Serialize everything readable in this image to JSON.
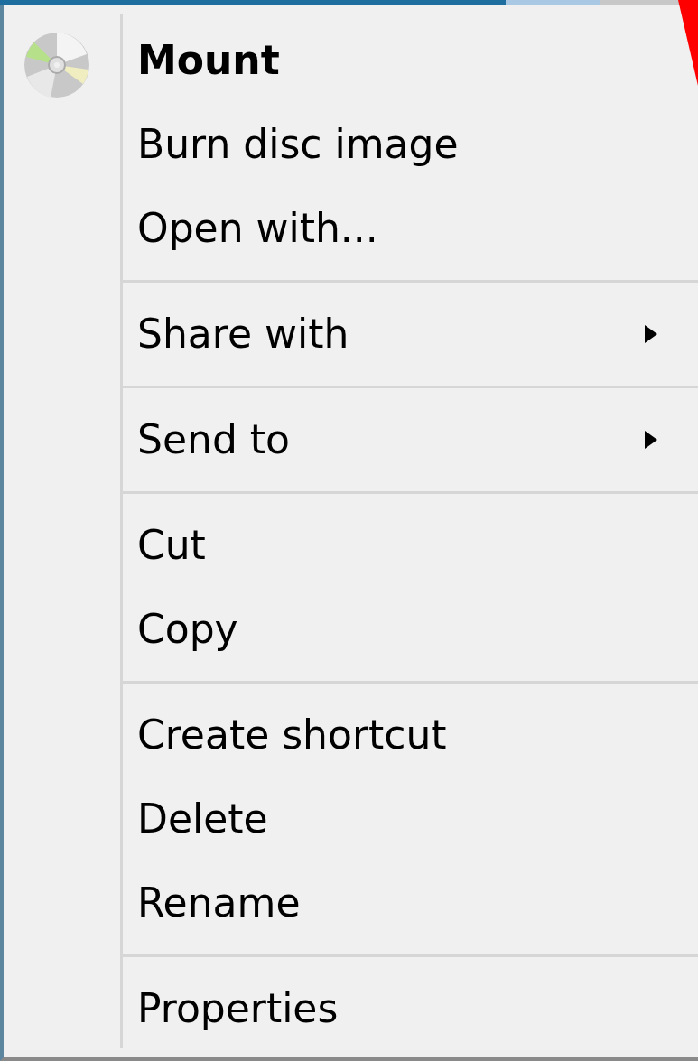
{
  "context_menu": {
    "items": [
      {
        "kind": "icon-item",
        "label": "Mount",
        "default": true,
        "submenu": false
      },
      {
        "kind": "item",
        "label": "Burn disc image",
        "default": false,
        "submenu": false
      },
      {
        "kind": "item",
        "label": "Open with...",
        "default": false,
        "submenu": false
      },
      {
        "kind": "separator"
      },
      {
        "kind": "item",
        "label": "Share with",
        "default": false,
        "submenu": true
      },
      {
        "kind": "separator"
      },
      {
        "kind": "item",
        "label": "Send to",
        "default": false,
        "submenu": true
      },
      {
        "kind": "separator"
      },
      {
        "kind": "item",
        "label": "Cut",
        "default": false,
        "submenu": false
      },
      {
        "kind": "item",
        "label": "Copy",
        "default": false,
        "submenu": false
      },
      {
        "kind": "separator"
      },
      {
        "kind": "item",
        "label": "Create shortcut",
        "default": false,
        "submenu": false
      },
      {
        "kind": "item",
        "label": "Delete",
        "default": false,
        "submenu": false
      },
      {
        "kind": "item",
        "label": "Rename",
        "default": false,
        "submenu": false
      },
      {
        "kind": "separator"
      },
      {
        "kind": "item",
        "label": "Properties",
        "default": false,
        "submenu": false
      }
    ]
  }
}
